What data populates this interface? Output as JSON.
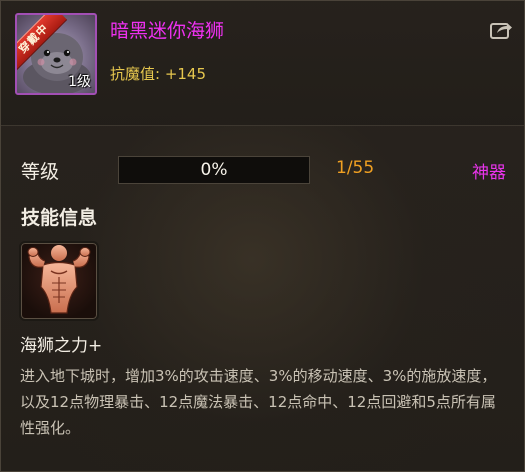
{
  "item": {
    "name": "暗黑迷你海狮",
    "equipped_ribbon": "穿戴中",
    "level_badge": "1级",
    "stat": "抗魔值: +145",
    "icon": "seal-pet-icon",
    "name_color": "#ee31f0"
  },
  "header": {
    "share_icon": "share-icon"
  },
  "level": {
    "label": "等级",
    "progress_percent": 0,
    "progress_text": "0%",
    "count": "1/55",
    "rarity": "神器",
    "rarity_color": "#e934ec"
  },
  "skill": {
    "heading": "技能信息",
    "icon": "muscle-flex-icon",
    "name": "海狮之力+",
    "description": "进入地下城时，增加3%的攻击速度、3%的移动速度、3%的施放速度，以及12点物理暴击、12点魔法暴击、12点命中、12点回避和5点所有属性强化。"
  }
}
